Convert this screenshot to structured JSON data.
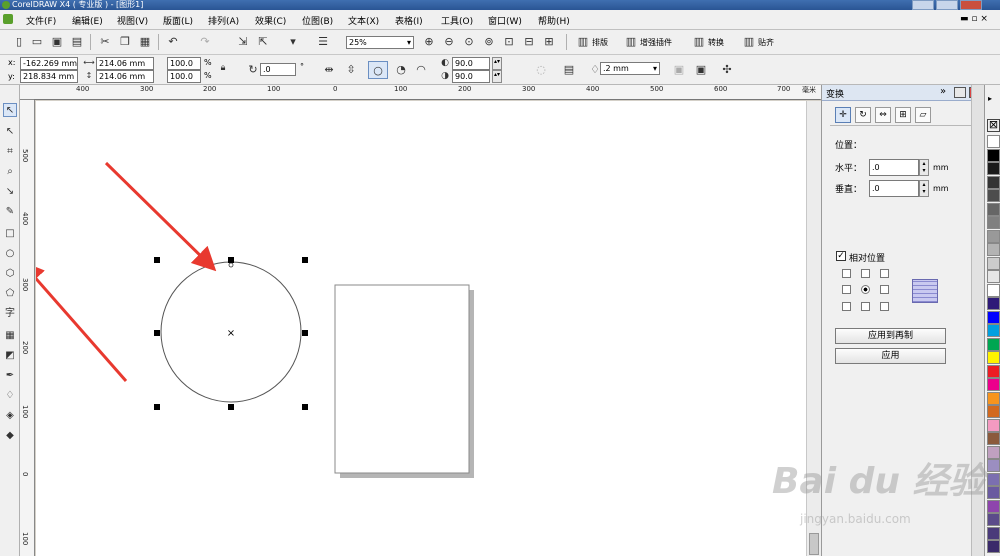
{
  "title_bar": {
    "text": "CorelDRAW X4 ( 专业版 ) - [图形1]"
  },
  "menu": [
    "文件(F)",
    "编辑(E)",
    "视图(V)",
    "版面(L)",
    "排列(A)",
    "效果(C)",
    "位图(B)",
    "文本(X)",
    "表格(I)",
    "工具(O)",
    "窗口(W)",
    "帮助(H)"
  ],
  "toolbar": {
    "zoom": "25%",
    "typeset": "排版",
    "enhance_plugin": "增强插件",
    "convert": "转换",
    "align": "贴齐"
  },
  "property_bar": {
    "x_label": "x:",
    "x_value": "-162.269 mm",
    "y_label": "y:",
    "y_value": "218.834 mm",
    "width": "214.06 mm",
    "height": "214.06 mm",
    "scale_w": "100.0",
    "scale_h": "100.0",
    "percent": "%",
    "rotation": ".0",
    "degree": "°",
    "start_angle": "90.0",
    "end_angle": "90.0",
    "outline_width": ".2 mm"
  },
  "ruler": {
    "h_ticks": [
      "400",
      "300",
      "200",
      "100",
      "0",
      "100",
      "200",
      "300",
      "400",
      "500",
      "600",
      "700"
    ],
    "h_unit": "毫米",
    "v_ticks": [
      "500",
      "400",
      "300",
      "200",
      "100",
      "0",
      "100"
    ]
  },
  "tools": [
    "pick-tool",
    "shape-tool",
    "crop-tool",
    "zoom-tool",
    "freehand-tool",
    "smart-fill-tool",
    "rectangle-tool",
    "ellipse-tool",
    "polygon-tool",
    "basic-shapes-tool",
    "text-tool",
    "table-tool",
    "interactive-blend-tool",
    "eyedropper-tool",
    "outline-tool",
    "fill-tool",
    "interactive-fill-tool"
  ],
  "text_tool_glyph": "字",
  "docker": {
    "title": "变换",
    "position_label": "位置：",
    "horizontal_label": "水平：",
    "horizontal_value": ".0",
    "vertical_label": "垂直：",
    "vertical_value": ".0",
    "unit": "mm",
    "relative_label": "相对位置",
    "relative_checked": true,
    "apply_duplicate": "应用到再制",
    "apply": "应用"
  },
  "palette_colors": [
    "#ffffff",
    "#000000",
    "#1a1a1a",
    "#333333",
    "#4d4d4d",
    "#666666",
    "#808080",
    "#999999",
    "#b3b3b3",
    "#cccccc",
    "#e6e6e6",
    "#ffffff",
    "#2e1a78",
    "#0000ff",
    "#00a0e0",
    "#00a651",
    "#fff200",
    "#ed1c24",
    "#ec008c",
    "#f7941d",
    "#d2691e",
    "#f49ac1",
    "#8b5a3c",
    "#c0a0c0",
    "#9b8ec0",
    "#7b6fb0",
    "#6a5aa0",
    "#8e44ad",
    "#5b4b8a",
    "#4a3a7a",
    "#3a2a6a"
  ],
  "watermark": {
    "brand": "Bai du 经验",
    "url": "jingyan.baidu.com"
  },
  "accent": "#e8392f"
}
